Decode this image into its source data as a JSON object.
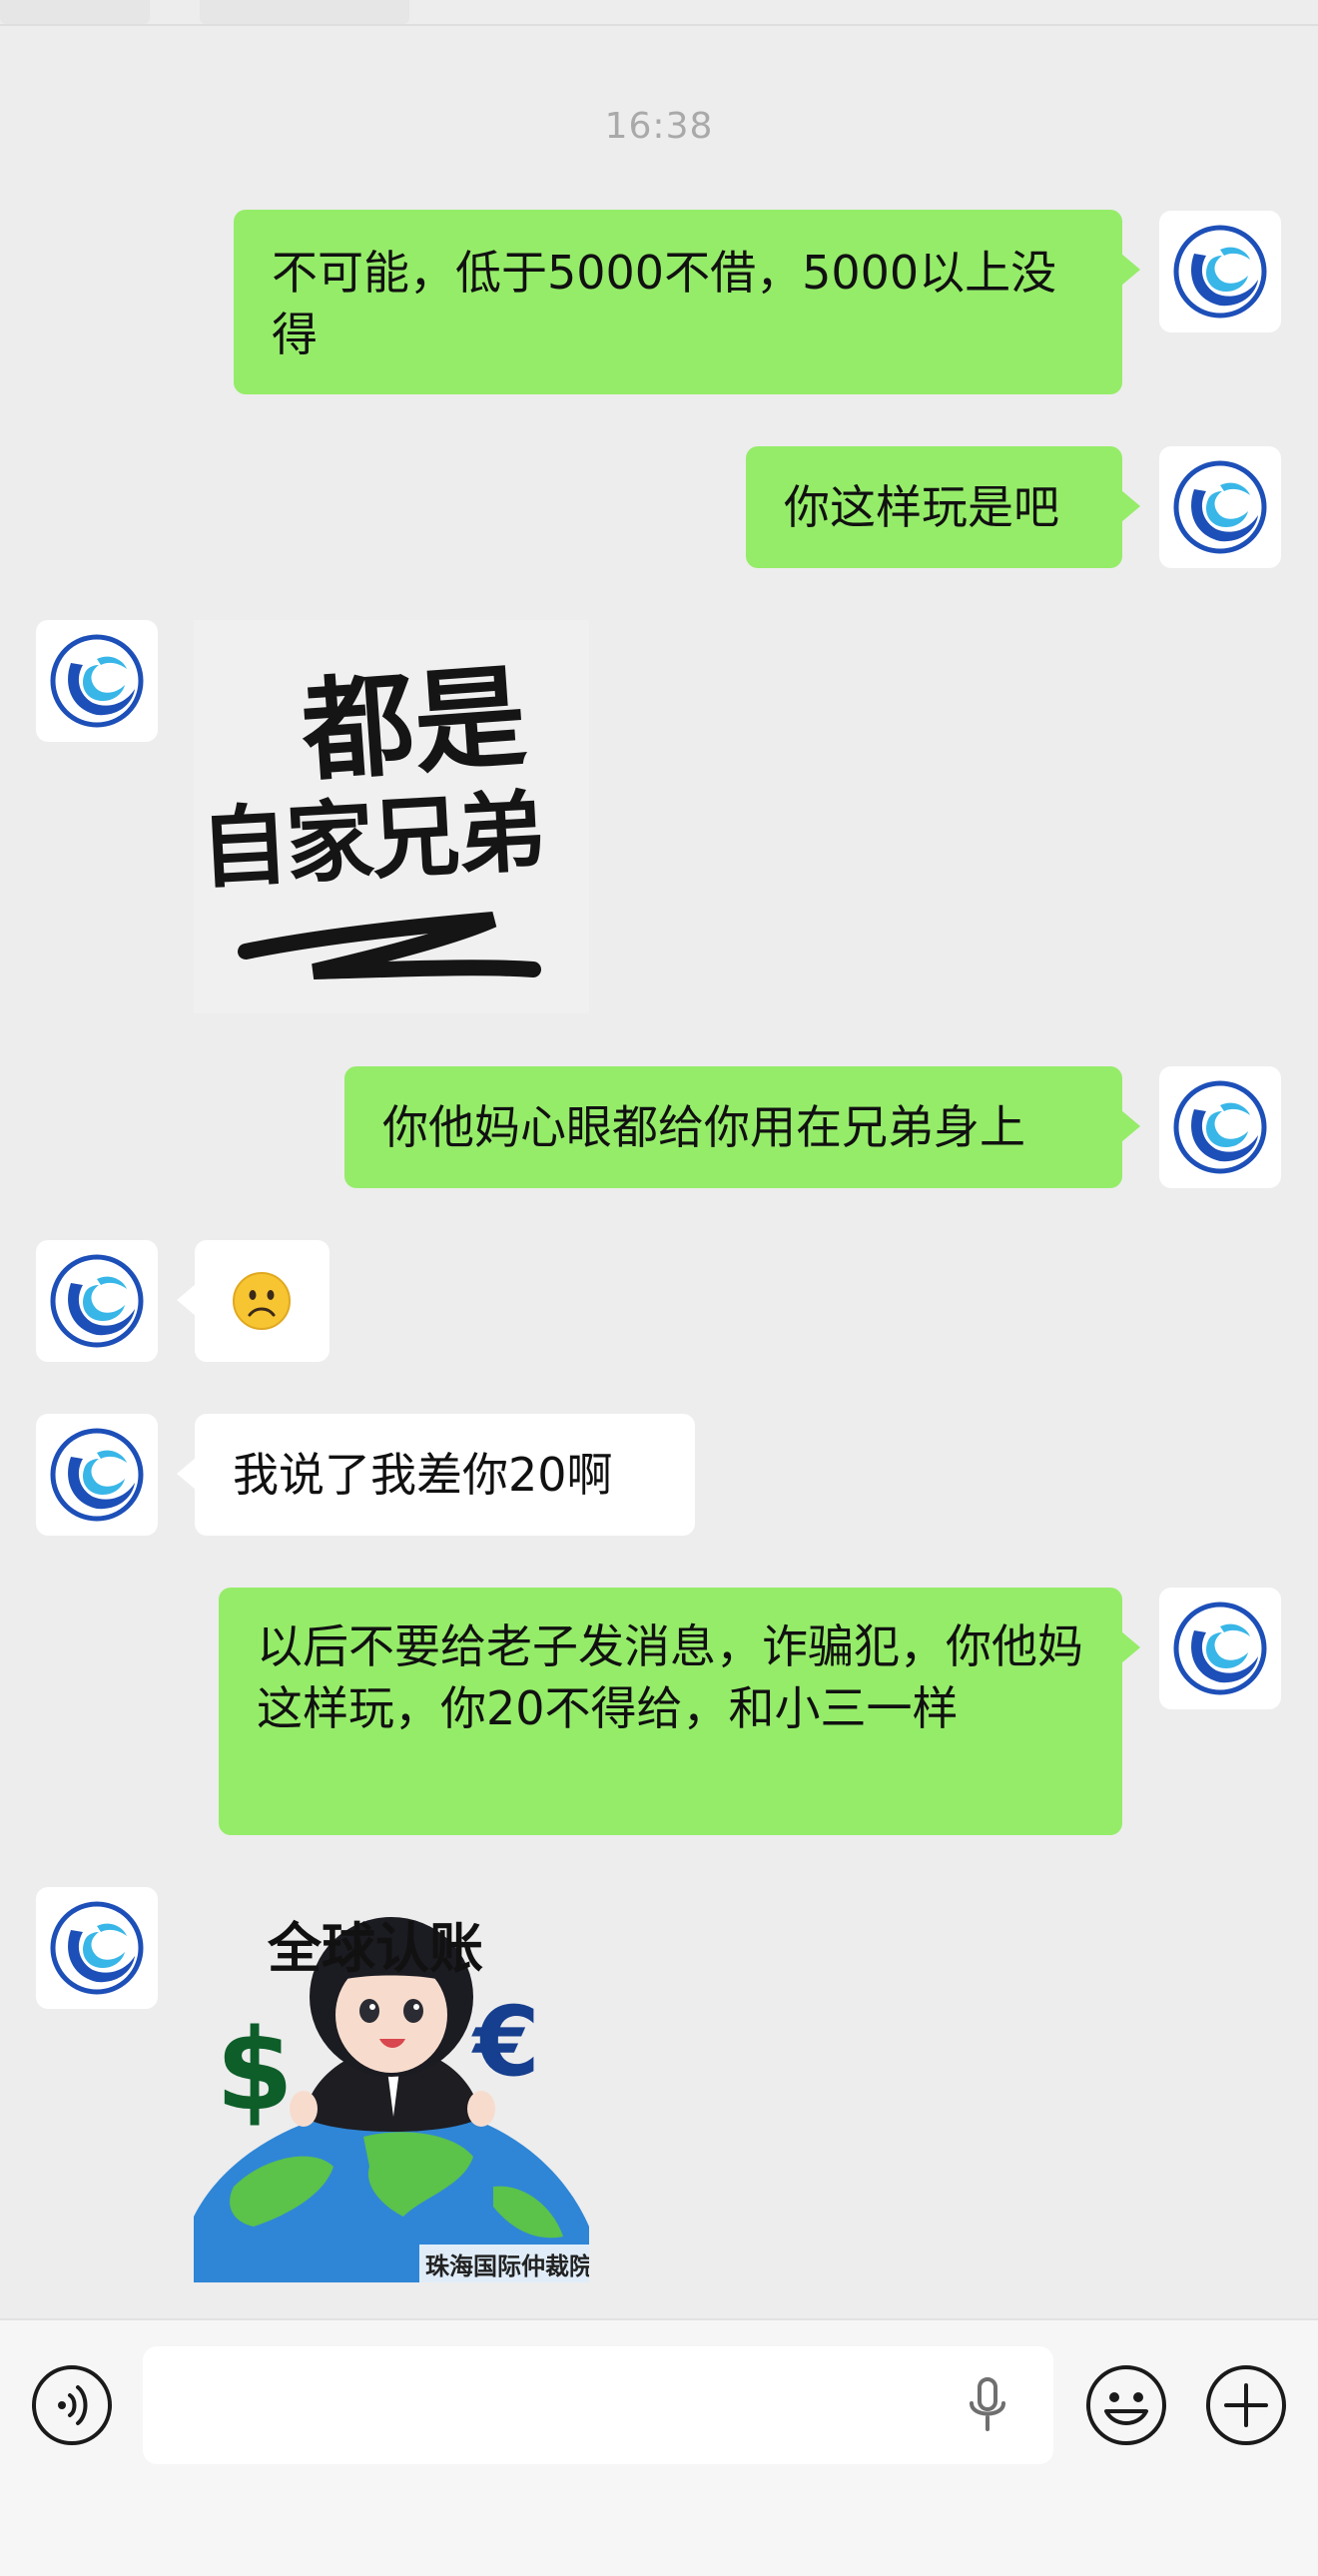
{
  "timestamp": "16:38",
  "messages": [
    {
      "side": "out",
      "type": "text",
      "text": "不可能，低于5000不借，5000以上没得"
    },
    {
      "side": "out",
      "type": "text",
      "text": "你这样玩是吧"
    },
    {
      "side": "in",
      "type": "sticker",
      "sticker_text_line1": "都是",
      "sticker_text_line2": "自家兄弟"
    },
    {
      "side": "out",
      "type": "text",
      "text": "你他妈心眼都给你用在兄弟身上"
    },
    {
      "side": "in",
      "type": "emoji",
      "emoji": "☹️"
    },
    {
      "side": "in",
      "type": "text",
      "text": "我说了我差你20啊"
    },
    {
      "side": "out",
      "type": "text",
      "text": "以后不要给老子发消息，诈骗犯，你他妈这样玩，你20不得给，和小三一样"
    },
    {
      "side": "in",
      "type": "sticker",
      "sticker_title": "全球认账",
      "sticker_left_symbol": "$",
      "sticker_right_symbol": "€",
      "sticker_caption": "珠海国际仲裁院"
    }
  ],
  "bottom_bar": {
    "voice_toggle_icon": "voice-toggle-icon",
    "input_value": "",
    "mic_icon": "microphone-icon",
    "emoji_icon": "emoji-icon",
    "more_icon": "plus-icon"
  },
  "colors": {
    "background": "#ededed",
    "outgoing_bubble": "#95ec69",
    "incoming_bubble": "#ffffff",
    "avatar_blue": "#1d4fb8",
    "avatar_cyan": "#38b6e8"
  }
}
